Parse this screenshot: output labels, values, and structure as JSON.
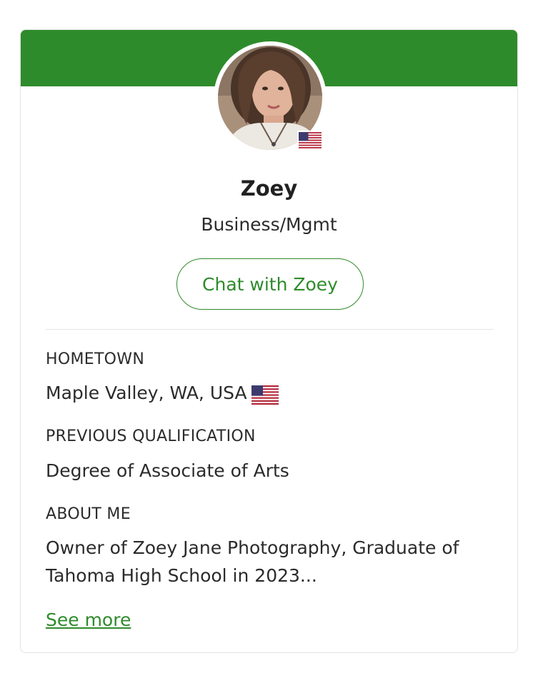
{
  "profile": {
    "name": "Zoey",
    "subject": "Business/Mgmt",
    "chat_label": "Chat with Zoey",
    "flag_icon": "us-flag-icon"
  },
  "details": {
    "hometown_label": "HOMETOWN",
    "hometown_value": "Maple Valley, WA, USA",
    "qualification_label": "PREVIOUS QUALIFICATION",
    "qualification_value": "Degree of Associate of Arts",
    "about_label": "ABOUT ME",
    "about_value": "Owner of Zoey Jane Photography, Graduate of Tahoma High School in 2023...",
    "see_more_label": "See more"
  },
  "colors": {
    "accent": "#2e8b2b",
    "text": "#2b2b2b",
    "border": "#e3e3e3"
  }
}
